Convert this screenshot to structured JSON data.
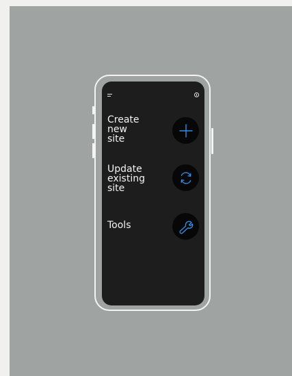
{
  "colors": {
    "page_background": "#f0f0ee",
    "backdrop": "#9fa3a2",
    "phone_screen": "#1d1d1d",
    "button_background": "#070707",
    "accent": "#2e8ee8",
    "text": "#f3f3f3"
  },
  "topbar": {
    "left_icon": "menu-icon",
    "right_icon": "info-icon"
  },
  "actions": [
    {
      "label": "Create\nnew\nsite",
      "icon": "plus-icon"
    },
    {
      "label": "Update\nexisting\nsite",
      "icon": "refresh-icon"
    },
    {
      "label": "Tools",
      "icon": "wrench-icon"
    }
  ]
}
